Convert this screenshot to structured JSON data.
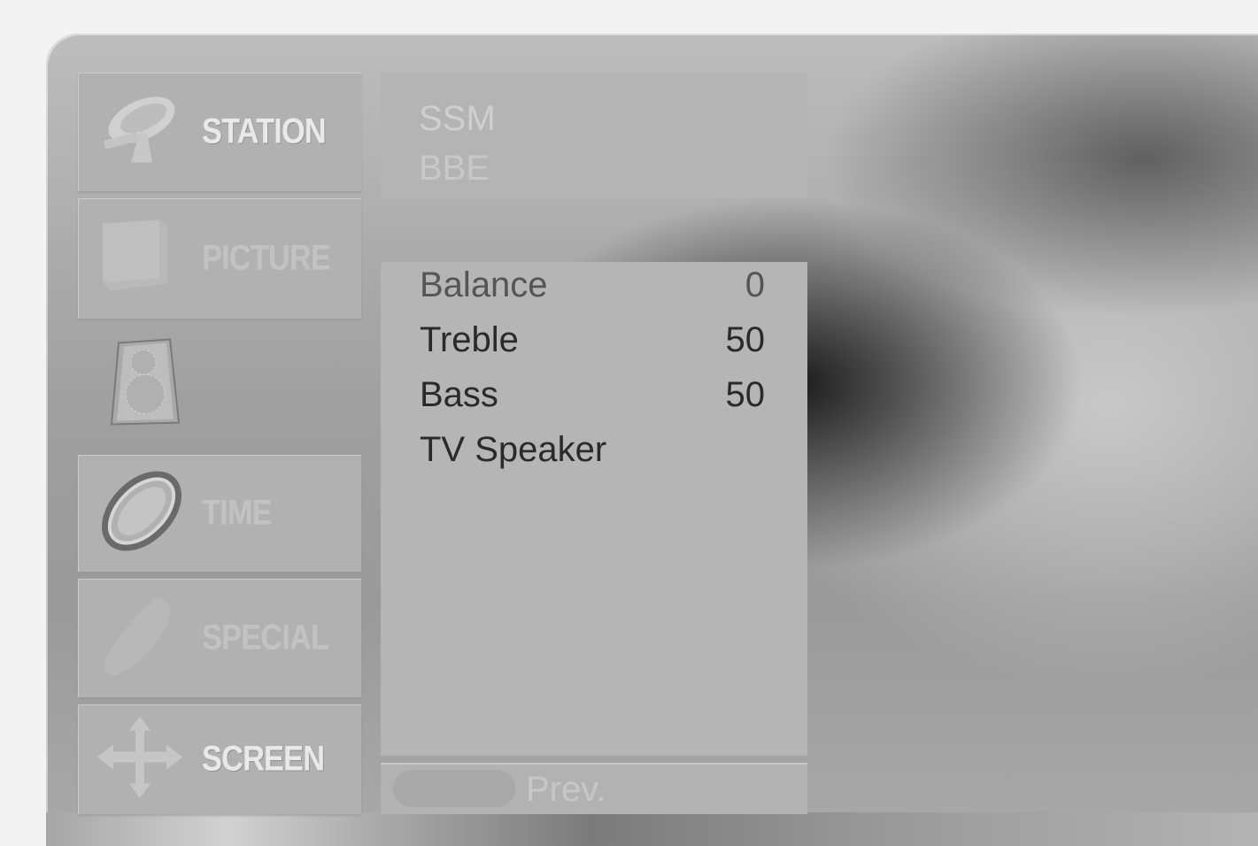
{
  "menu": {
    "items": [
      {
        "label": "STATION",
        "icon": "satellite-dish-icon"
      },
      {
        "label": "PICTURE",
        "icon": "picture-icon"
      },
      {
        "label": "",
        "icon": "speaker-icon"
      },
      {
        "label": "TIME",
        "icon": "clock-icon"
      },
      {
        "label": "SPECIAL",
        "icon": "special-icon"
      },
      {
        "label": "SCREEN",
        "icon": "move-arrows-icon"
      }
    ]
  },
  "top_panel": {
    "options": [
      "SSM",
      "BBE"
    ]
  },
  "sound_panel": {
    "rows": [
      {
        "name": "Balance",
        "value": "0"
      },
      {
        "name": "Treble",
        "value": "50"
      },
      {
        "name": "Bass",
        "value": "50"
      },
      {
        "name": "TV Speaker",
        "value": ""
      }
    ]
  },
  "footer": {
    "prev_label": "Prev."
  }
}
